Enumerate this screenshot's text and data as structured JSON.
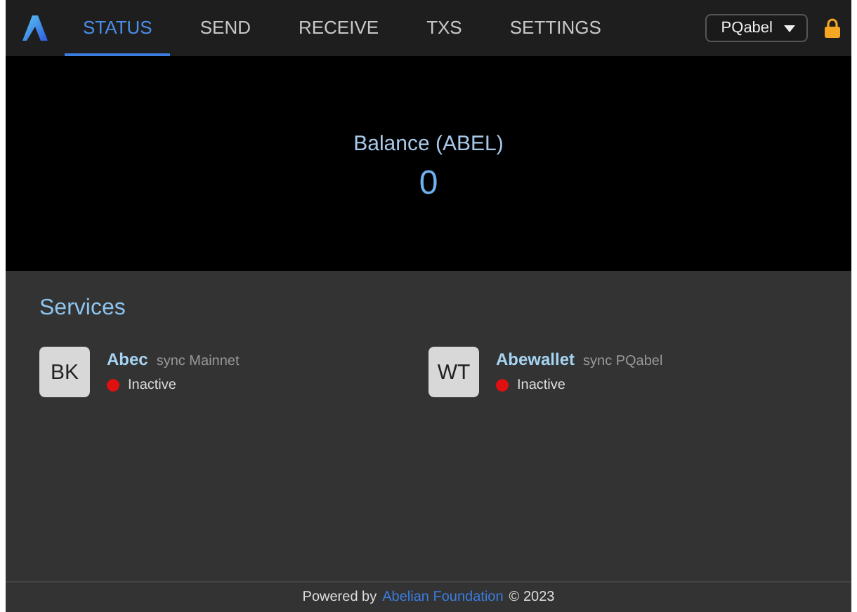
{
  "nav": {
    "tabs": [
      {
        "label": "STATUS",
        "selected": true
      },
      {
        "label": "SEND",
        "selected": false
      },
      {
        "label": "RECEIVE",
        "selected": false
      },
      {
        "label": "TXS",
        "selected": false
      },
      {
        "label": "SETTINGS",
        "selected": false
      }
    ],
    "network": "PQabel",
    "locked": true
  },
  "balance": {
    "label": "Balance (ABEL)",
    "value": "0"
  },
  "services": {
    "title": "Services",
    "items": [
      {
        "badge": "BK",
        "name": "Abec",
        "sync": "sync Mainnet",
        "status": "Inactive",
        "color": "#e01010"
      },
      {
        "badge": "WT",
        "name": "Abewallet",
        "sync": "sync PQabel",
        "status": "Inactive",
        "color": "#e01010"
      }
    ]
  },
  "footer": {
    "prefix": "Powered by",
    "link": "Abelian Foundation",
    "suffix": "© 2023"
  }
}
